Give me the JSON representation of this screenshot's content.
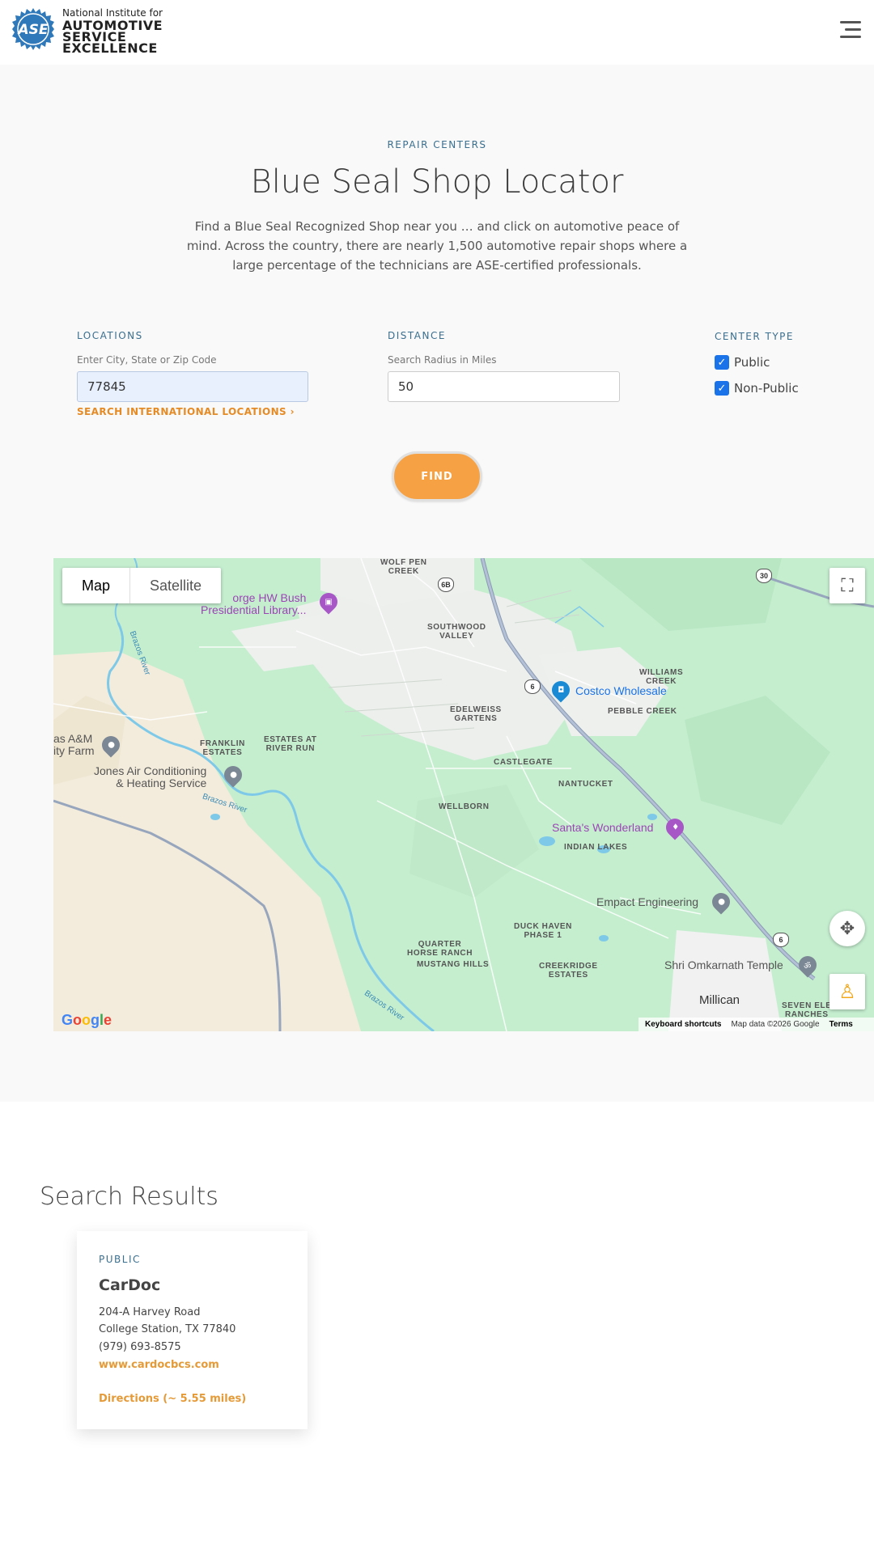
{
  "header": {
    "logo_mark": "ASE",
    "logo_line1": "National Institute for",
    "logo_line2": "AUTOMOTIVE",
    "logo_line3": "SERVICE",
    "logo_line4": "EXCELLENCE"
  },
  "hero": {
    "eyebrow": "REPAIR CENTERS",
    "title": "Blue Seal Shop Locator",
    "intro": "Find a Blue Seal Recognized Shop near you … and click on automotive peace of mind. Across the country, there are nearly 1,500 automotive repair shops where a large percentage of the technicians are ASE-certified professionals."
  },
  "search": {
    "locations_label": "LOCATIONS",
    "locations_hint": "Enter City, State or Zip Code",
    "locations_value": "77845",
    "intl_link": "SEARCH INTERNATIONAL LOCATIONS",
    "distance_label": "DISTANCE",
    "distance_hint": "Search Radius in Miles",
    "distance_value": "50",
    "center_type_label": "CENTER TYPE",
    "public_label": "Public",
    "public_checked": true,
    "nonpublic_label": "Non-Public",
    "nonpublic_checked": true,
    "find_label": "FIND"
  },
  "map": {
    "map_tab": "Map",
    "satellite_tab": "Satellite",
    "google": "Google",
    "footer_shortcuts": "Keyboard shortcuts",
    "footer_data": "Map data ©2026 Google",
    "footer_terms": "Terms",
    "labels": {
      "wolf_pen": "WOLF PEN\nCREEK",
      "bush_library": "orge HW Bush\nPresidential Library...",
      "southwood": "SOUTHWOOD\nVALLEY",
      "williams": "WILLIAMS\nCREEK",
      "costco": "Costco Wholesale",
      "pebble": "PEBBLE CREEK",
      "edelweiss": "EDELWEISS\nGARTENS",
      "am_farm": "as A&M\nity Farm",
      "franklin": "FRANKLIN\nESTATES",
      "estates_river": "ESTATES AT\nRIVER RUN",
      "jones": "Jones Air Conditioning\n& Heating Service",
      "castlegate": "CASTLEGATE",
      "nantucket": "NANTUCKET",
      "wellborn": "WELLBORN",
      "santas": "Santa's Wonderland",
      "indian_lakes": "INDIAN LAKES",
      "empact": "Empact Engineering",
      "duck_haven": "DUCK HAVEN\nPHASE 1",
      "quarter_horse": "QUARTER\nHORSE RANCH",
      "mustang": "MUSTANG HILLS",
      "creekridge": "CREEKRIDGE\nESTATES",
      "omkarnath": "Shri Omkarnath Temple",
      "millican": "Millican",
      "seven_elm": "SEVEN ELE\nRANCHES",
      "brazos1": "Brazos River",
      "brazos2": "Brazos River",
      "brazos3": "Brazos River"
    },
    "shields": {
      "s68": "6B",
      "s6a": "6",
      "s6b": "6",
      "s30": "30"
    }
  },
  "results": {
    "title": "Search Results",
    "card": {
      "badge": "PUBLIC",
      "name": "CarDoc",
      "address1": "204-A Harvey Road",
      "address2": "College Station, TX 77840",
      "phone": "(979) 693-8575",
      "website": "www.cardocbcs.com",
      "directions": "Directions (~ 5.55 miles)"
    }
  },
  "colors": {
    "accent_blue": "#3a6f8f",
    "accent_orange": "#f6a144",
    "link_orange": "#e58b26",
    "map_green": "#c8efd3"
  }
}
